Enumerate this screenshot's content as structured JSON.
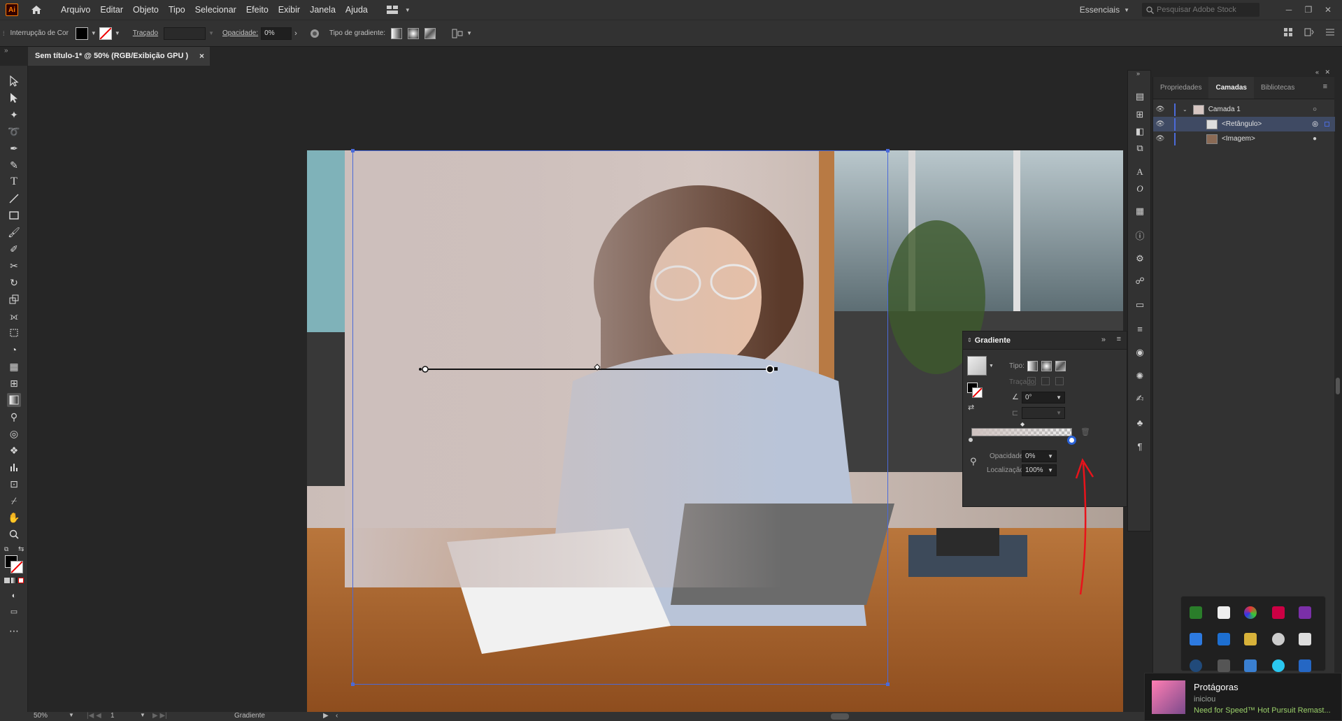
{
  "app": {
    "logo_text": "Ai"
  },
  "menu": [
    "Arquivo",
    "Editar",
    "Objeto",
    "Tipo",
    "Selecionar",
    "Efeito",
    "Exibir",
    "Janela",
    "Ajuda"
  ],
  "workspace": "Essenciais",
  "stock_search": {
    "placeholder": "Pesquisar Adobe Stock"
  },
  "control_bar": {
    "color_interrupt_label": "Interrupção de Cor",
    "stroke_label": "Traçado",
    "opacity_label": "Opacidade:",
    "opacity_value": "0%",
    "gradient_type_label": "Tipo de gradiente:"
  },
  "document_tab": {
    "title": "Sem título-1* @ 50% (RGB/Exibição GPU )",
    "close": "×"
  },
  "gradient_panel": {
    "title": "Gradiente",
    "tipo_label": "Tipo:",
    "tracado_label": "Traçado:",
    "angle_value": "0°",
    "opacity_label": "Opacidade:",
    "opacity_value": "0%",
    "location_label": "Localização:",
    "location_value": "100%"
  },
  "layers_panel": {
    "tabs": [
      "Propriedades",
      "Camadas",
      "Bibliotecas"
    ],
    "active_tab": "Camadas",
    "layers": [
      {
        "name": "Camada 1"
      },
      {
        "name": "<Retângulo>"
      },
      {
        "name": "<Imagem>"
      }
    ]
  },
  "status_bar": {
    "zoom": "50%",
    "page": "1",
    "tool": "Gradiente"
  },
  "notification": {
    "name": "Protágoras",
    "action": "iniciou",
    "game": "Need for Speed™ Hot Pursuit Remast..."
  },
  "colors": {
    "accent": "#4b6ad9",
    "annotation_arrow": "#e8131b",
    "ui_bg": "#323232",
    "canvas_bg": "#262626"
  }
}
